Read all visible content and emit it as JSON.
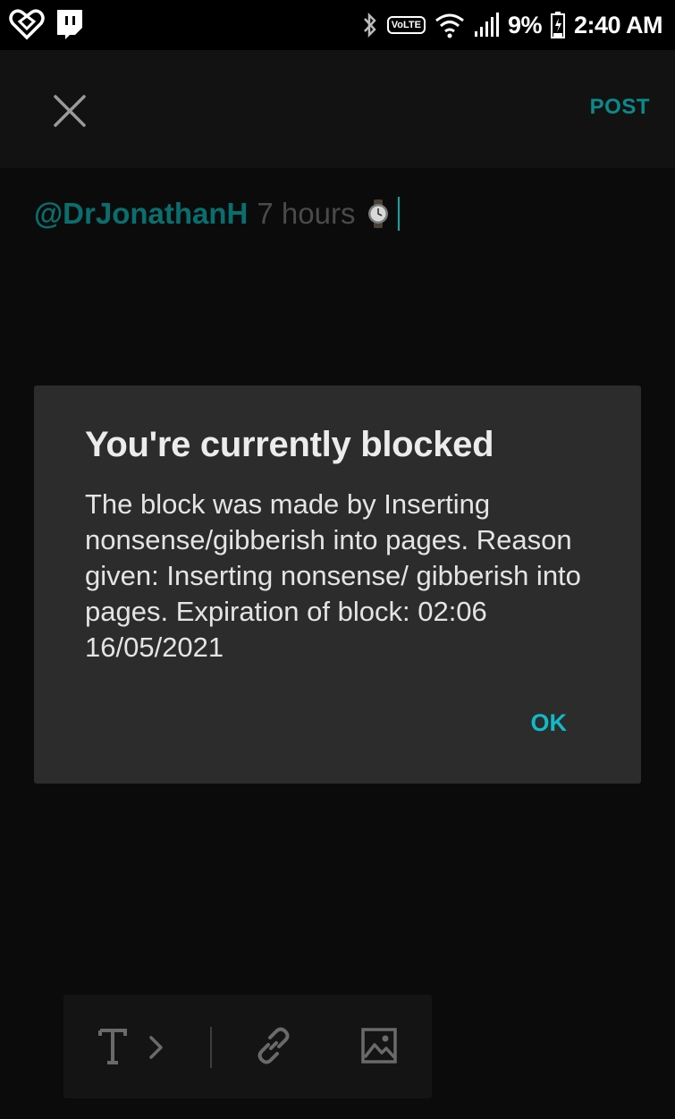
{
  "status_bar": {
    "battery": "9%",
    "time": "2:40 AM",
    "volte": "VoLTE",
    "icons": [
      "app-heart-icon",
      "twitch-icon",
      "bluetooth-icon",
      "volte-icon",
      "wifi-icon",
      "signal-icon",
      "battery-icon"
    ]
  },
  "header": {
    "post_label": "POST",
    "close_icon": "close-icon"
  },
  "composer": {
    "mention": "@DrJonathanH",
    "text": "7 hours",
    "emoji": "watch-icon"
  },
  "dialog": {
    "title": "You're currently blocked",
    "body": "The block was made by Inserting nonsense/gibberish into pages. Reason given: Inserting nonsense/ gibberish into pages. Expiration of block: 02:06 16/05/2021",
    "ok_label": "OK"
  },
  "toolbar": {
    "text_style_icon": "text-format-icon",
    "link_icon": "link-icon",
    "image_icon": "image-icon"
  },
  "colors": {
    "accent": "#12b9c6",
    "dim_accent": "#0a6e6e",
    "dialog_bg": "#2c2c2c",
    "header_bg": "#121212"
  }
}
